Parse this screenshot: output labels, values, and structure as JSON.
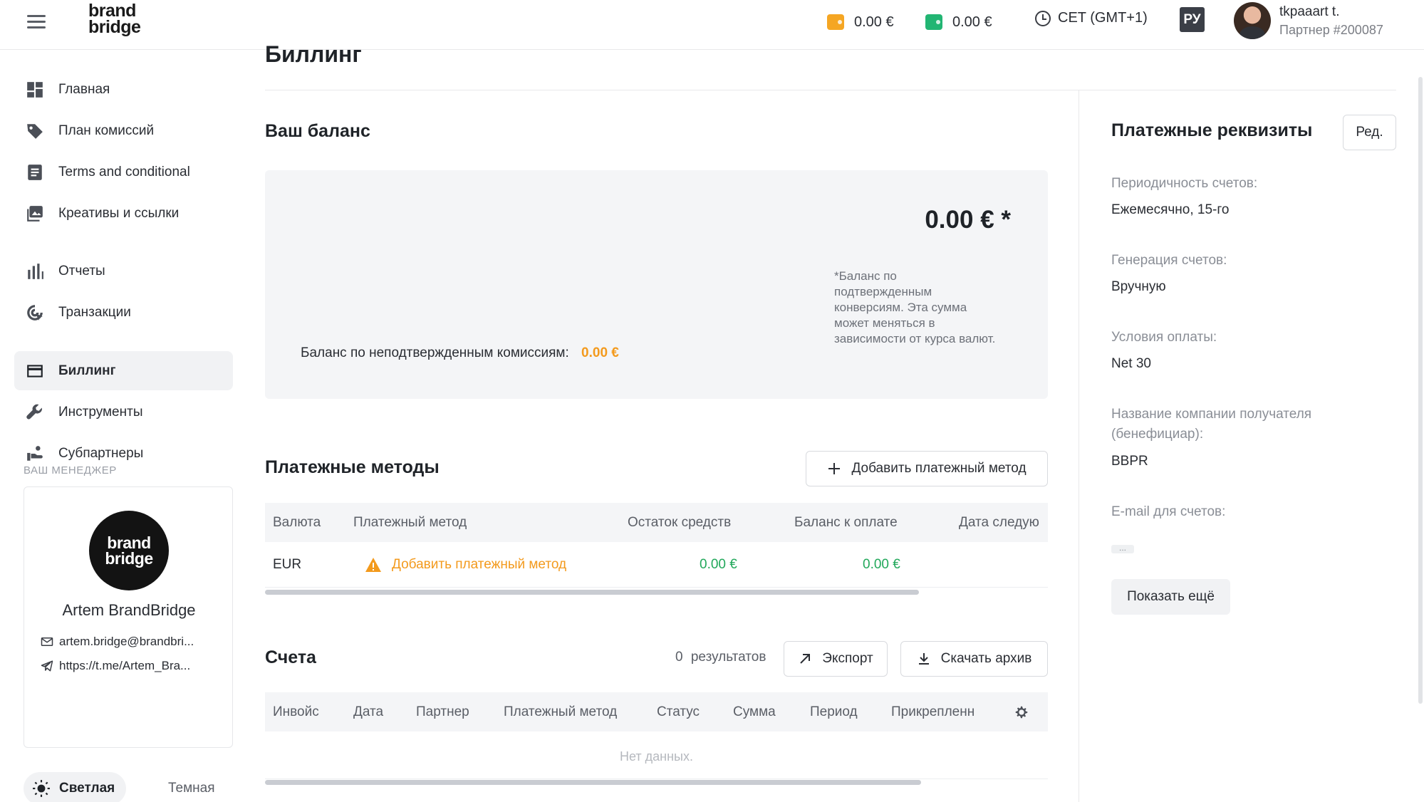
{
  "header": {
    "logo_line1": "brand",
    "logo_line2": "bridge",
    "wallet1": "0.00 €",
    "wallet2": "0.00 €",
    "timezone": "CET (GMT+1)",
    "language": "РУ",
    "user_name": "tkpaaart t.",
    "partner_id": "Партнер #200087",
    "colors": {
      "wallet1": "#f5a623",
      "wallet2": "#22b573"
    }
  },
  "sidebar": {
    "items": [
      {
        "label": "Главная",
        "icon": "dashboard-icon"
      },
      {
        "label": "План комиссий",
        "icon": "tag-icon"
      },
      {
        "label": "Terms and conditional",
        "icon": "document-icon"
      },
      {
        "label": "Креативы и ссылки",
        "icon": "image-icon"
      },
      {
        "label": "Отчеты",
        "icon": "bar-chart-icon"
      },
      {
        "label": "Транзакции",
        "icon": "transactions-icon"
      },
      {
        "label": "Биллинг",
        "icon": "card-icon",
        "active": true
      },
      {
        "label": "Инструменты",
        "icon": "wrench-icon"
      },
      {
        "label": "Субпартнеры",
        "icon": "subpartners-icon"
      }
    ],
    "manager_label": "ВАШ МЕНЕДЖЕР",
    "manager": {
      "logo_line1": "brand",
      "logo_line2": "bridge",
      "name": "Artem BrandBridge",
      "email": "artem.bridge@brandbri...",
      "telegram": "https://t.me/Artem_Bra..."
    },
    "theme_light": "Светлая",
    "theme_dark": "Темная"
  },
  "main": {
    "title": "Биллинг",
    "balance_heading": "Ваш баланс",
    "balance_value": "0.00 € *",
    "balance_note": "*Баланс по подтвержденным конверсиям. Эта сумма может меняться в зависимости от курса валют.",
    "unconfirmed_label": "Баланс по неподтвержденным комиссиям:",
    "unconfirmed_value": "0.00 €",
    "methods_heading": "Платежные методы",
    "add_method_button": "Добавить платежный метод",
    "methods_table": {
      "columns": [
        "Валюта",
        "Платежный метод",
        "Остаток средств",
        "Баланс к оплате",
        "Дата следую"
      ],
      "rows": [
        {
          "currency": "EUR",
          "method": "Добавить платежный метод",
          "remaining": "0.00 €",
          "to_pay": "0.00 €"
        }
      ]
    },
    "invoices_heading": "Счета",
    "results_count": "0",
    "results_label": "результатов",
    "export_button": "Экспорт",
    "download_button": "Скачать архив",
    "invoices_table": {
      "columns": [
        "Инвойс",
        "Дата",
        "Партнер",
        "Платежный метод",
        "Статус",
        "Сумма",
        "Период",
        "Прикрепленн"
      ],
      "empty_text": "Нет данных."
    }
  },
  "details": {
    "title": "Платежные реквизиты",
    "edit_button": "Ред.",
    "fields": [
      {
        "label": "Периодичность счетов:",
        "value": "Ежемесячно, 15-го"
      },
      {
        "label": "Генерация счетов:",
        "value": "Вручную"
      },
      {
        "label": "Условия оплаты:",
        "value": "Net 30"
      },
      {
        "label": "Название компании получателя (бенефициар):",
        "value": "BBPR"
      },
      {
        "label": "E-mail для счетов:",
        "value": "..."
      }
    ],
    "show_more": "Показать ещё"
  }
}
